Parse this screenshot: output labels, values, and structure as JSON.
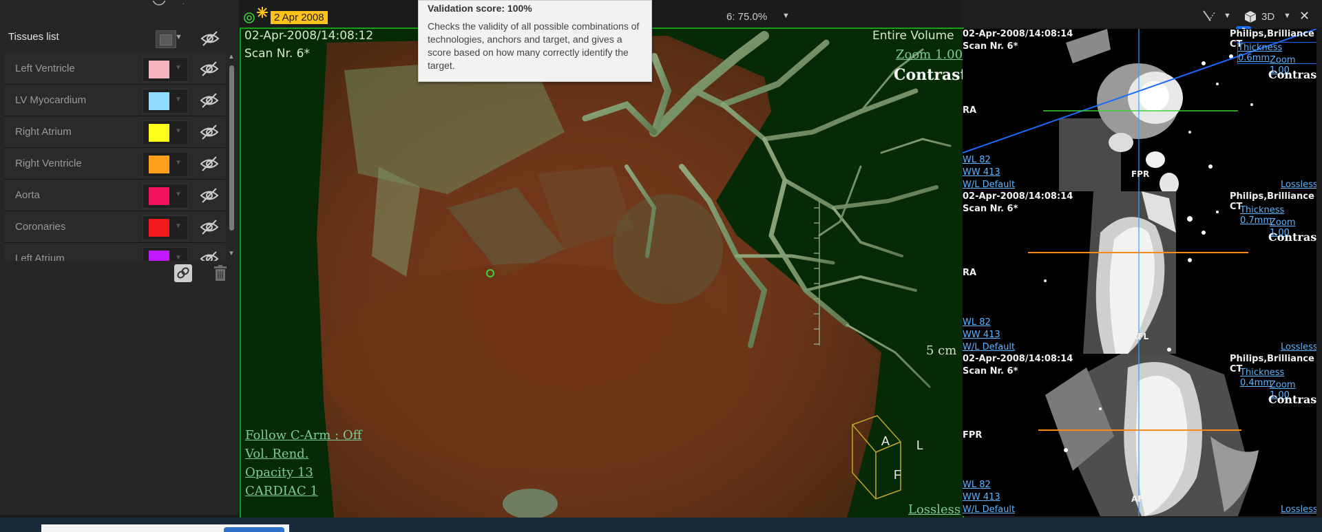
{
  "tissues": {
    "title": "Tissues list",
    "items": [
      {
        "label": "Left Ventricle",
        "color": "#f7b5c0"
      },
      {
        "label": "LV Myocardium",
        "color": "#8fdcff"
      },
      {
        "label": "Right Atrium",
        "color": "#ffff1a"
      },
      {
        "label": "Right Ventricle",
        "color": "#ffa11a"
      },
      {
        "label": "Aorta",
        "color": "#f0155e"
      },
      {
        "label": "Coronaries",
        "color": "#f21a1a"
      },
      {
        "label": "Left Atrium",
        "color": "#c11aff"
      }
    ]
  },
  "viewer3d": {
    "date_badge": "2 Apr 2008",
    "zoom_label": "6: 75.0%",
    "datetime": "02-Apr-2008/14:08:12",
    "scan": "Scan Nr. 6*",
    "volume": "Entire Volume",
    "zoom": "Zoom 1.00",
    "contrast": "Contrast",
    "scale": "5 cm",
    "follow_carm": "Follow C-Arm : Off",
    "render_mode": "Vol. Rend.",
    "opacity": "Opacity  13",
    "preset": "CARDIAC 1",
    "compression": "Lossless",
    "orientation": {
      "a": "A",
      "l": "L",
      "f": "F"
    }
  },
  "tooltip": {
    "title": "Validation score: 100%",
    "body": "Checks the validity of all possible combinations of technologies, anchors and target, and gives a score based on how many correctly identify the target."
  },
  "toolbar_right": {
    "layout": "3D"
  },
  "mpr": [
    {
      "datetime": "02-Apr-2008/14:08:14",
      "scan": "Scan Nr. 6*",
      "scanner": "Philips,Brilliance CT",
      "thickness": "Thickness 0.6mm",
      "zoom": "Zoom 1.00",
      "contrast": "Contrast",
      "side": "RA",
      "bottom_marker": "FPR",
      "wl": "WL     82",
      "ww": "WW   413",
      "wl_preset": "W/L Default",
      "compression": "Lossless"
    },
    {
      "datetime": "02-Apr-2008/14:08:14",
      "scan": "Scan Nr. 6*",
      "scanner": "Philips,Brilliance CT",
      "thickness": "Thickness 0.7mm",
      "zoom": "Zoom 1.00",
      "contrast": "Contrast",
      "side": "RA",
      "bottom_marker": "AFL",
      "wl": "WL     82",
      "ww": "WW   413",
      "wl_preset": "W/L Default",
      "compression": "Lossless"
    },
    {
      "datetime": "02-Apr-2008/14:08:14",
      "scan": "Scan Nr. 6*",
      "scanner": "Philips,Brilliance CT",
      "thickness": "Thickness 0.4mm",
      "zoom": "Zoom 1.00",
      "contrast": "Contrast",
      "side": "FPR",
      "bottom_marker": "AFL",
      "wl": "WL     82",
      "ww": "WW   413",
      "wl_preset": "W/L Default",
      "compression": "Lossless"
    }
  ],
  "colors": {
    "viewport_border": "#17a017",
    "date_badge_bg": "#ffc21a",
    "link_blue": "#5fb4ff",
    "line_blue": "#1a6bff",
    "line_orange": "#ff8a1a",
    "line_green": "#3bd23b"
  }
}
